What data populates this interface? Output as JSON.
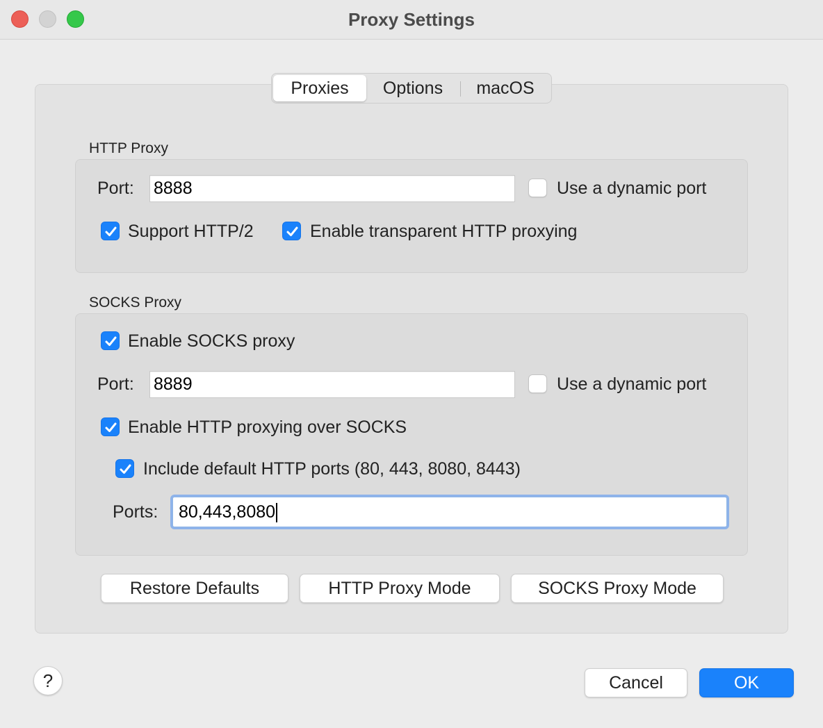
{
  "window": {
    "title": "Proxy Settings"
  },
  "tabs": [
    {
      "label": "Proxies",
      "selected": true
    },
    {
      "label": "Options",
      "selected": false
    },
    {
      "label": "macOS",
      "selected": false
    }
  ],
  "http_proxy": {
    "group_label": "HTTP Proxy",
    "port_label": "Port:",
    "port_value": "8888",
    "dynamic_port": {
      "label": "Use a dynamic port",
      "checked": false
    },
    "support_http2": {
      "label": "Support HTTP/2",
      "checked": true
    },
    "transparent": {
      "label": "Enable transparent HTTP proxying",
      "checked": true
    }
  },
  "socks_proxy": {
    "group_label": "SOCKS Proxy",
    "enable": {
      "label": "Enable SOCKS proxy",
      "checked": true
    },
    "port_label": "Port:",
    "port_value": "8889",
    "dynamic_port": {
      "label": "Use a dynamic port",
      "checked": false
    },
    "http_over_socks": {
      "label": "Enable HTTP proxying over SOCKS",
      "checked": true
    },
    "include_default_ports": {
      "label": "Include default HTTP ports (80, 443, 8080, 8443)",
      "checked": true
    },
    "ports_label": "Ports:",
    "ports_value": "80,443,8080"
  },
  "mode_buttons": {
    "restore_defaults": "Restore Defaults",
    "http_mode": "HTTP Proxy Mode",
    "socks_mode": "SOCKS Proxy Mode"
  },
  "footer": {
    "help": "?",
    "cancel": "Cancel",
    "ok": "OK"
  },
  "colors": {
    "accent": "#1a82fb",
    "focus_ring": "#8eb3ea"
  }
}
